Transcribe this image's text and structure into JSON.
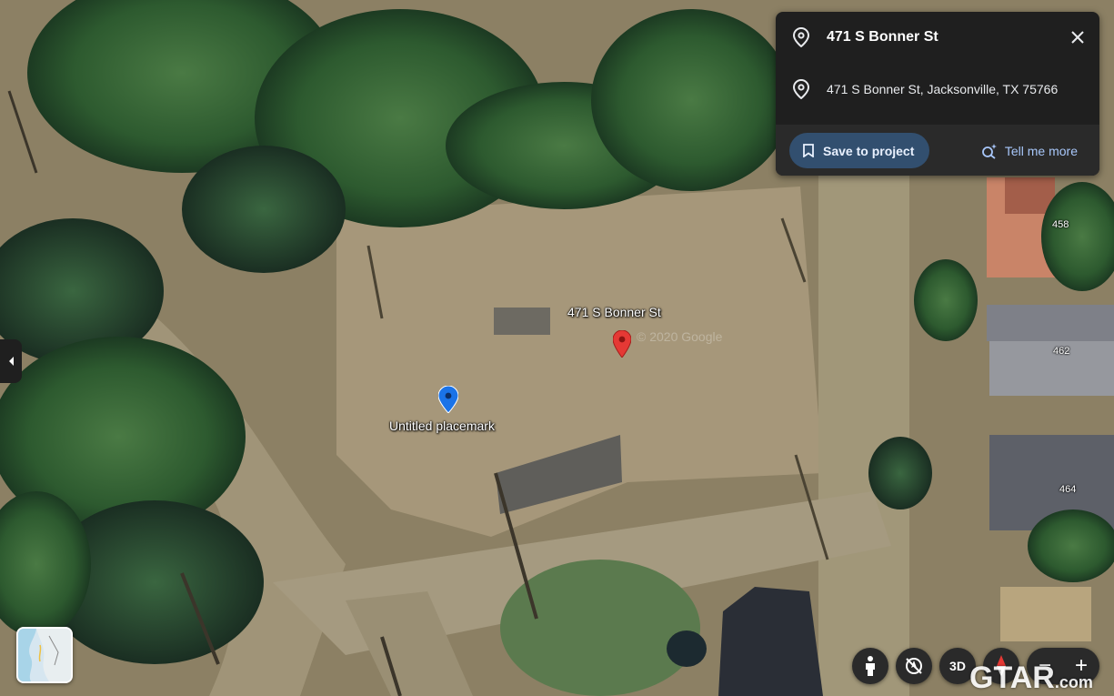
{
  "info_card": {
    "title": "471 S Bonner St",
    "address": "471 S Bonner St, Jacksonville, TX 75766",
    "save_label": "Save to project",
    "tell_label": "Tell me more",
    "icons": {
      "pin": "location-pin-icon",
      "close": "close-icon",
      "save": "bookmark-icon",
      "tell": "sparkle-search-icon"
    }
  },
  "map": {
    "markers": [
      {
        "label": "471 S Bonner St",
        "color": "#e53935",
        "icon": "red-pin-icon"
      },
      {
        "label": "Untitled placemark",
        "color": "#1a73e8",
        "icon": "blue-pin-icon"
      }
    ],
    "house_numbers": [
      "458",
      "462",
      "464"
    ],
    "watermark": "© 2020 Google"
  },
  "controls": {
    "threed_label": "3D",
    "zoom_out": "−",
    "zoom_in": "+",
    "icons": [
      "person-icon",
      "compass-reset-icon",
      "3d-toggle",
      "compass-icon"
    ]
  },
  "branding": {
    "logo_text": "GTAR",
    "logo_suffix": ".com"
  },
  "colors": {
    "card_bg": "#1f1f1f",
    "save_button_bg": "#324f6f",
    "link_color": "#a8c7fa"
  }
}
